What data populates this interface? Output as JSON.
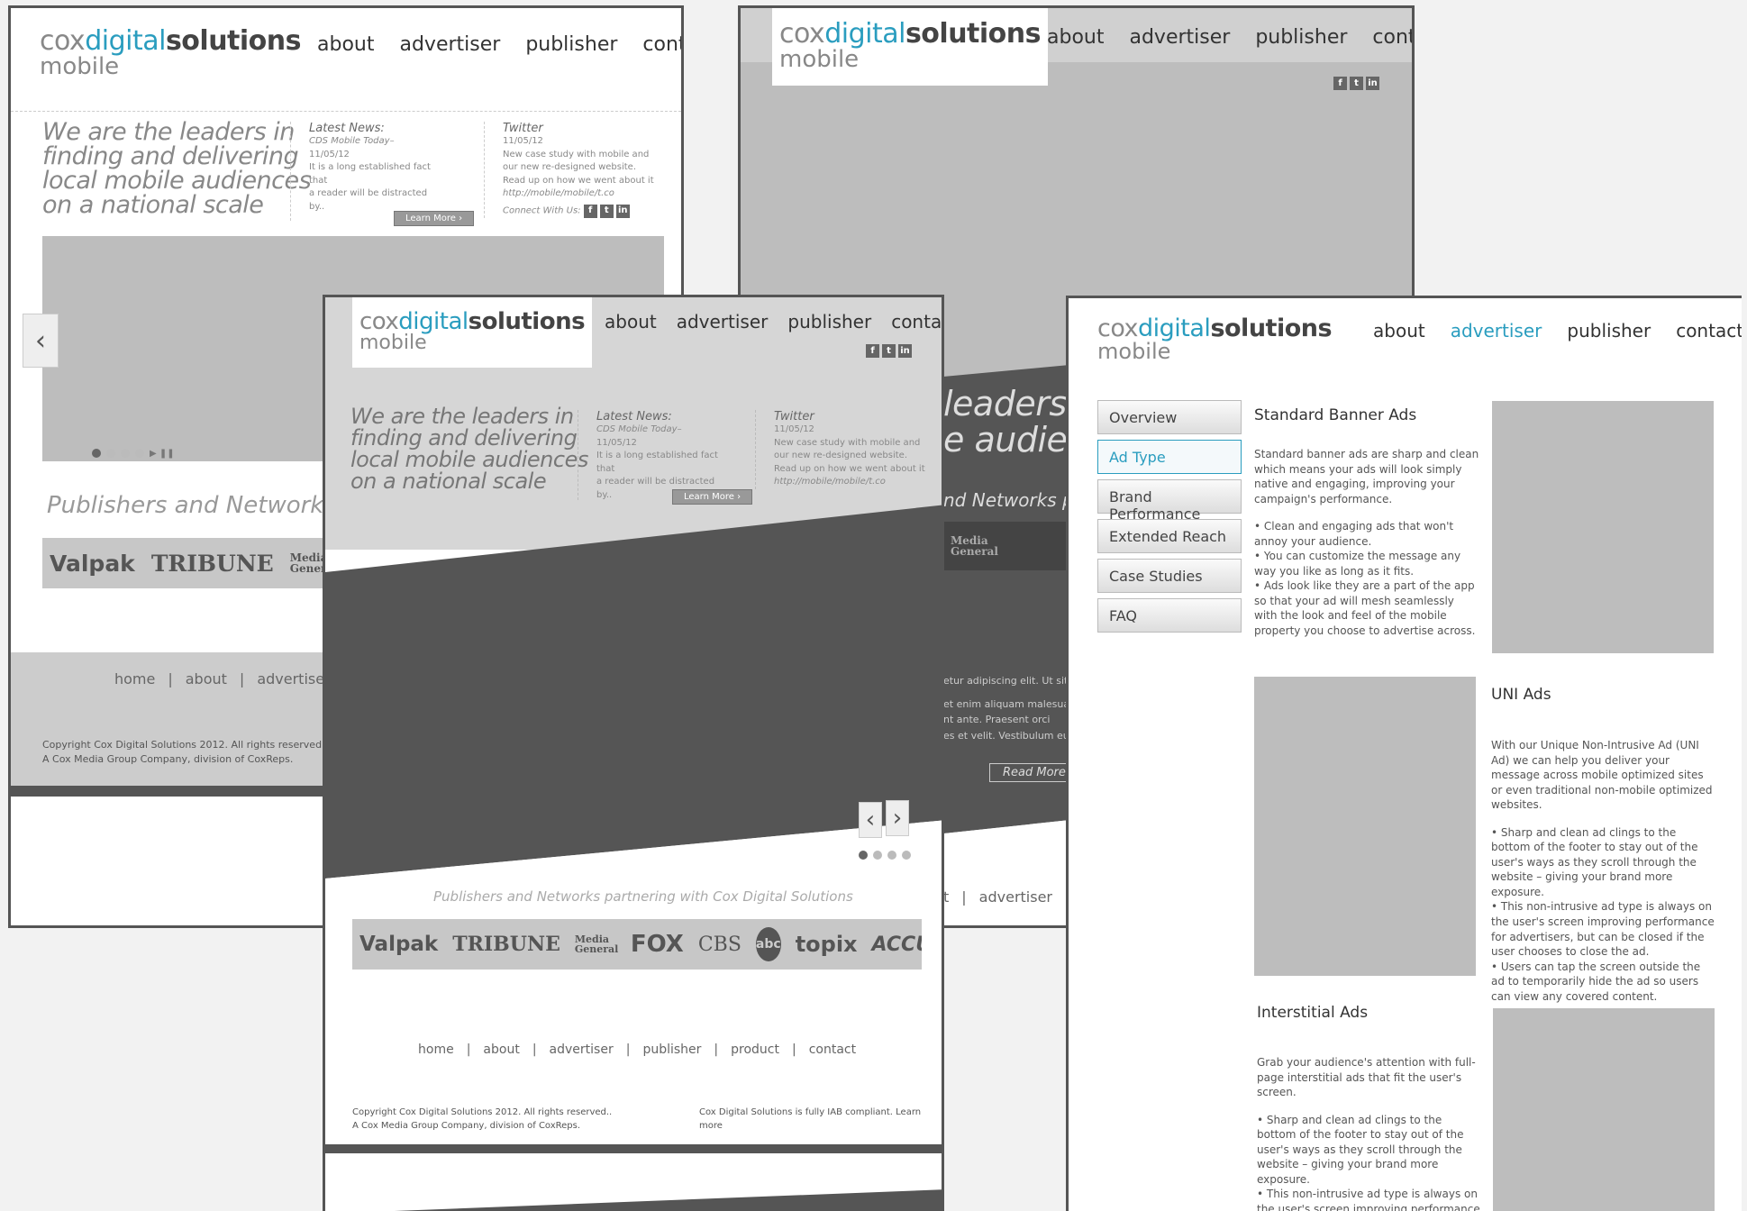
{
  "logo": {
    "cox": "cox",
    "digital": "digital",
    "solutions": "solutions",
    "mobile": "mobile"
  },
  "nav": {
    "about": "about",
    "advertiser": "advertiser",
    "publisher": "publisher",
    "contact": "contact"
  },
  "hero": {
    "tagline": [
      "We are the leaders in",
      "finding and delivering",
      "local mobile audiences",
      "on a national scale"
    ],
    "tagline_fragment_1": "leaders in",
    "tagline_fragment_2": "e audienc"
  },
  "news": {
    "title": "Latest News:",
    "headline": "CDS Mobile Today–",
    "date": "11/05/12",
    "body": [
      "It is a long established fact that",
      "a reader will be distracted by.."
    ],
    "button": "Learn More"
  },
  "twitter": {
    "title": "Twitter",
    "date": "11/05/12",
    "body": [
      "New case study with mobile and",
      "our new re-designed website.",
      "Read up on how we went about it"
    ],
    "link": "http://mobile/mobile/t.co",
    "connect": "Connect With Us:"
  },
  "social": {
    "facebook": "f",
    "twitter": "t",
    "linkedin": "in"
  },
  "partners": {
    "heading_short": "Publishers and Networks par",
    "heading_full": "Publishers and Networks partnering with Cox Digital Solutions",
    "heading_frag": "nd Networks part",
    "logos": [
      "Valpak",
      "TRIBUNE",
      "Media General",
      "FOX",
      "CBS",
      "abc",
      "topix",
      "ACCU"
    ]
  },
  "footer": {
    "links": [
      "home",
      "about",
      "advertiser",
      "publisher",
      "product",
      "contact"
    ],
    "copyright": [
      "Copyright  Cox Digital Solutions 2012. All rights reserved..",
      "A Cox Media Group Company, division of CoxReps."
    ],
    "iab": "Cox Digital Solutions is fully IAB compliant. Learn more",
    "frag_t": "t",
    "frag_adv": "advertiser"
  },
  "page2": {
    "lorem": [
      "etur adipiscing elit. Ut sit",
      "et enim aliquam malesua-",
      "nt ante. Praesent orci",
      "es et velit. Vestibulum eu"
    ],
    "read_more": "Read More"
  },
  "page4": {
    "menu": [
      "Overview",
      "Ad Type",
      "Brand Performance",
      "Extended Reach",
      "Case Studies",
      "FAQ"
    ],
    "standard": {
      "title": "Standard Banner Ads",
      "intro": "Standard banner ads are sharp and clean which means your ads will look simply native and engaging, improving your campaign's performance.",
      "bullets": [
        "• Clean and engaging ads that won't annoy your audience.",
        "• You can customize the message any way you like as long as it fits.",
        "• Ads look like they are a part of the app so that your ad will mesh seamlessly with the look and feel of the mobile property you choose to advertise across."
      ]
    },
    "uni": {
      "title": "UNI Ads",
      "intro": "With our Unique Non-Intrusive Ad (UNI Ad) we can help you deliver your message across mobile optimized sites or even traditional non-mobile optimized websites.",
      "bullets": [
        "• Sharp and clean ad clings to the bottom of the footer to stay out of the user's ways as they scroll through the website – giving your brand more exposure.",
        "• This non-intrusive ad type is always on the user's screen improving performance for advertisers, but can be closed if the user chooses to close the ad.",
        "• Users can tap the screen outside the ad to temporarily hide the ad so users can view any covered content."
      ]
    },
    "interstitial": {
      "title": "Interstitial Ads",
      "intro": "Grab your audience's attention with full-page interstitial ads that fit the user's screen.",
      "bullets": [
        "• Sharp and clean ad clings to the bottom of the footer to stay out of the user's ways as they scroll through the website – giving your brand more exposure.",
        "• This non-intrusive ad type is always on the user's screen improving performance for advertisers, but can be closed if the user"
      ]
    }
  }
}
